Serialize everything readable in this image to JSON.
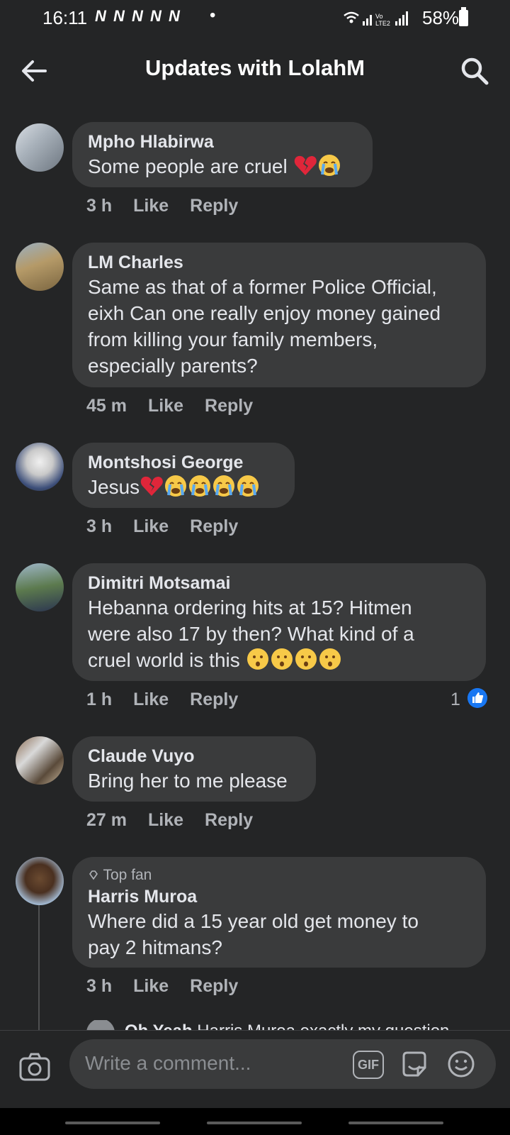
{
  "status_bar": {
    "time": "16:11",
    "notifications": "N N N N N",
    "dot": "•",
    "battery": "58%"
  },
  "header": {
    "title": "Updates with LolahM"
  },
  "comments": [
    {
      "name": "Mpho Hlabirwa",
      "text": "Some people are cruel",
      "emojis": [
        "broken-heart-icon",
        "crying-face-icon"
      ],
      "time": "3 h",
      "like": "Like",
      "reply": "Reply"
    },
    {
      "name": "LM Charles",
      "lines": [
        "Same as that of a former Police Official,",
        "eixh Can one really enjoy money gained",
        "from killing your family members,",
        "especially parents?"
      ],
      "time": "45 m",
      "like": "Like",
      "reply": "Reply"
    },
    {
      "name": "Montshosi George",
      "text": "Jesus",
      "emojis": [
        "broken-heart-icon",
        "crying-face-icon",
        "crying-face-icon",
        "crying-face-icon",
        "crying-face-icon"
      ],
      "time": "3 h",
      "like": "Like",
      "reply": "Reply"
    },
    {
      "name": "Dimitri Motsamai",
      "lines": [
        "Hebanna ordering hits at 15? Hitmen",
        "were also 17 by then?  What kind of a",
        "cruel world is this"
      ],
      "emojis": [
        "hushed-face-icon",
        "hushed-face-icon",
        "hushed-face-icon",
        "hushed-face-icon"
      ],
      "time": "1 h",
      "like": "Like",
      "reply": "Reply",
      "like_count": "1"
    },
    {
      "name": "Claude Vuyo",
      "text": "Bring her to me please",
      "time": "27 m",
      "like": "Like",
      "reply": "Reply"
    },
    {
      "badge": "Top fan",
      "name": "Harris Muroa",
      "lines": [
        "Where did a 15 year old get money to",
        "pay 2 hitmans?"
      ],
      "time": "3 h",
      "like": "Like",
      "reply": "Reply"
    }
  ],
  "partial_reply": {
    "name": "Oh Yeah",
    "text": "Harris Muroa  exactly my question"
  },
  "composer": {
    "placeholder": "Write a comment...",
    "gif_label": "GIF"
  }
}
